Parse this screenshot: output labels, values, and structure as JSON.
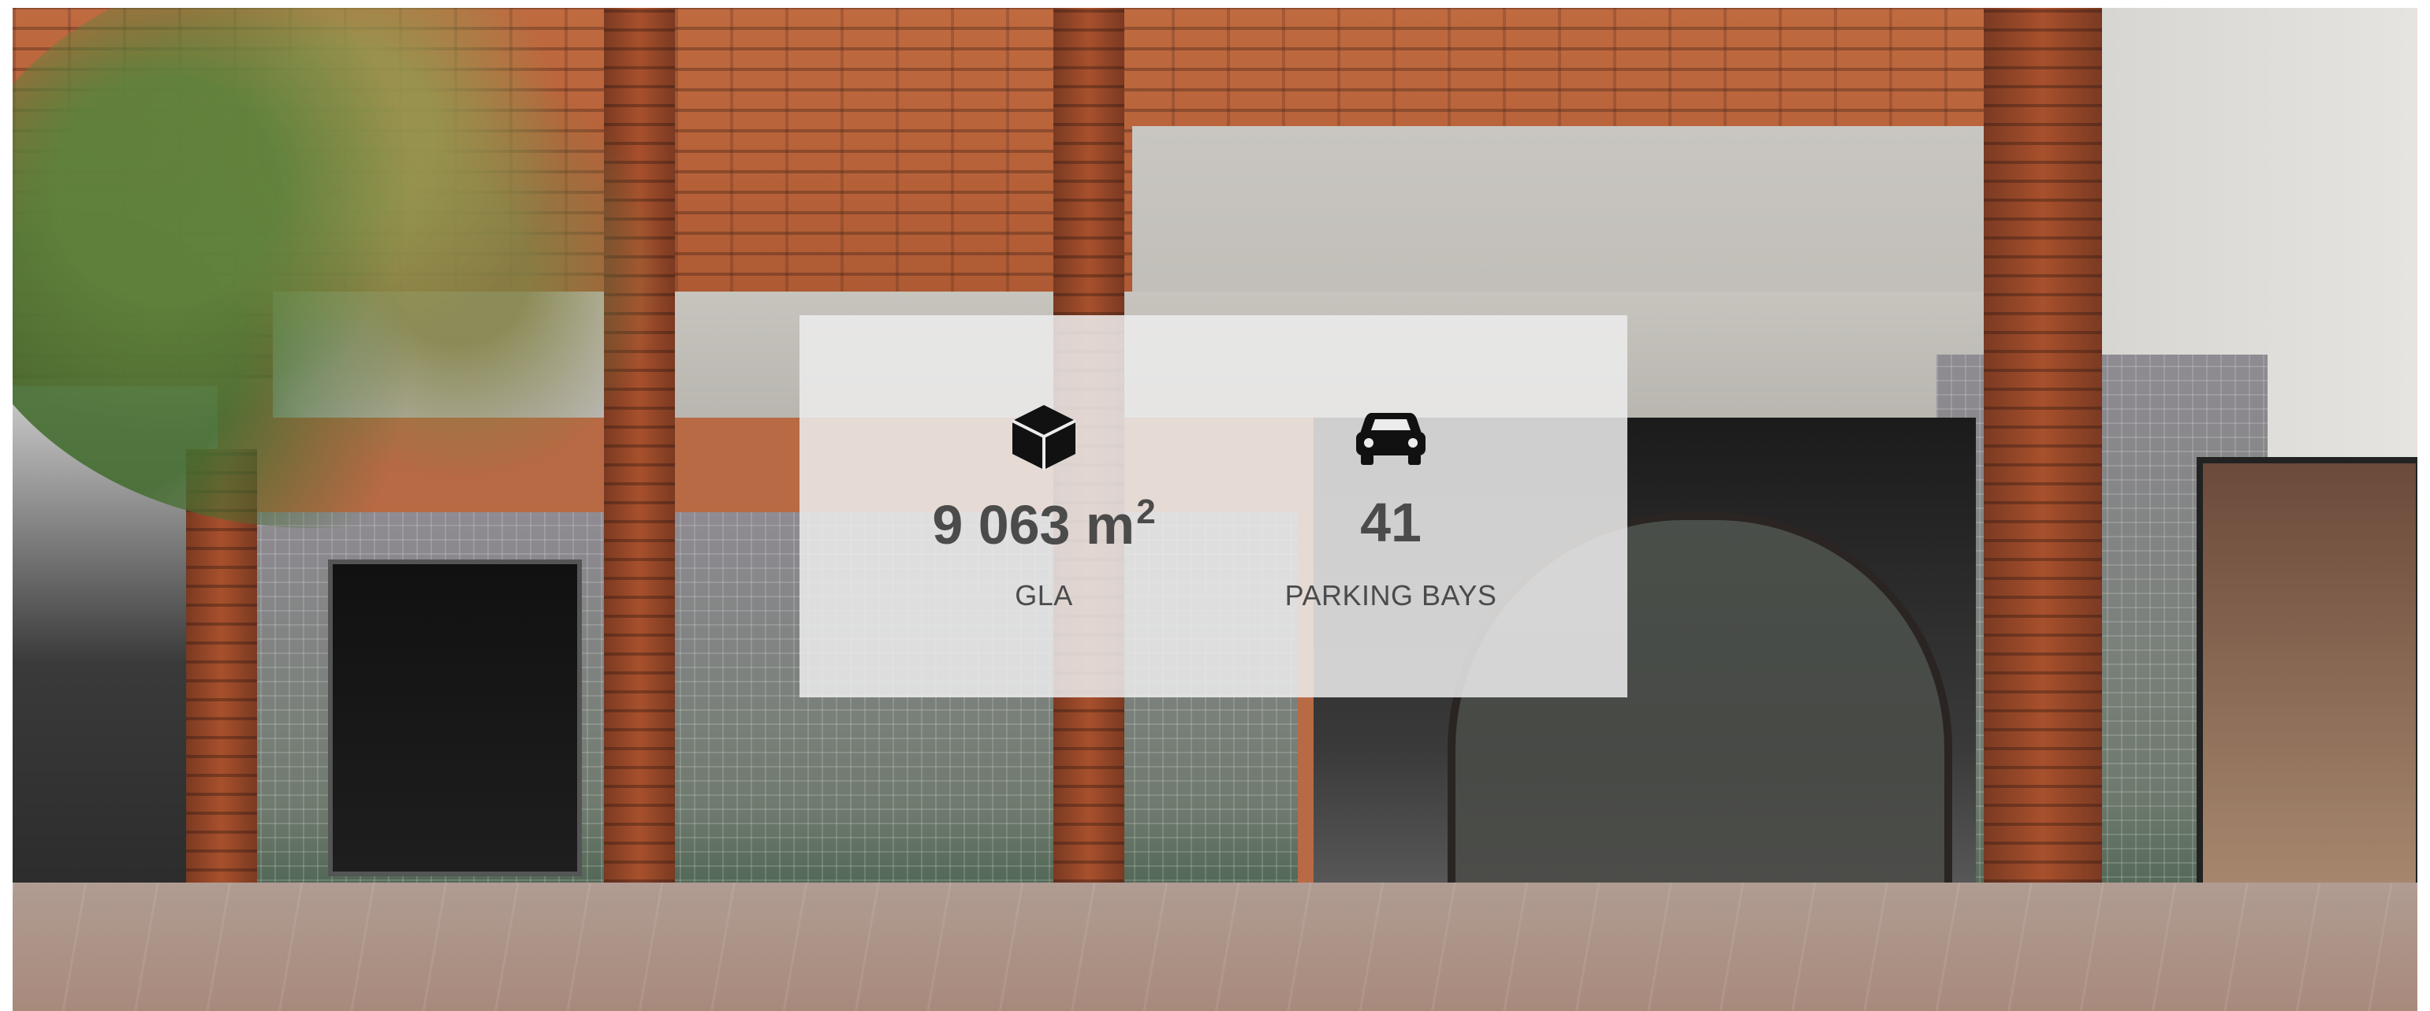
{
  "stats": {
    "gla": {
      "icon": "cube-icon",
      "value": "9 063 m",
      "unit_superscript": "2",
      "label": "GLA"
    },
    "parking": {
      "icon": "car-icon",
      "value": "41",
      "label": "PARKING BAYS"
    }
  },
  "colors": {
    "overlay_text": "#4b4b4b",
    "overlay_background": "#ececec"
  }
}
